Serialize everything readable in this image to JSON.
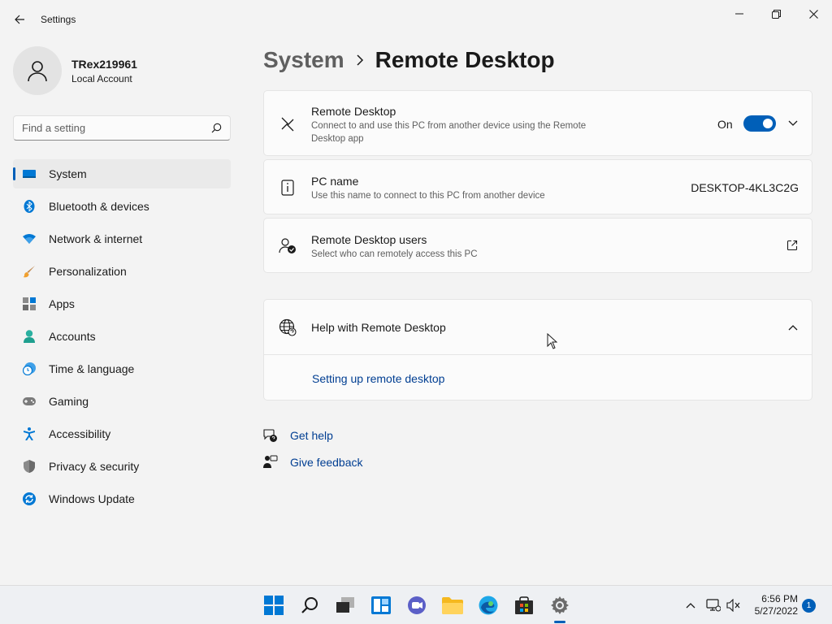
{
  "window": {
    "title": "Settings"
  },
  "profile": {
    "name": "TRex219961",
    "account_type": "Local Account"
  },
  "search": {
    "placeholder": "Find a setting"
  },
  "nav": {
    "items": [
      {
        "label": "System",
        "icon": "system-icon",
        "active": true
      },
      {
        "label": "Bluetooth & devices",
        "icon": "bluetooth-icon"
      },
      {
        "label": "Network & internet",
        "icon": "wifi-icon"
      },
      {
        "label": "Personalization",
        "icon": "brush-icon"
      },
      {
        "label": "Apps",
        "icon": "apps-icon"
      },
      {
        "label": "Accounts",
        "icon": "person-icon"
      },
      {
        "label": "Time & language",
        "icon": "clock-globe-icon"
      },
      {
        "label": "Gaming",
        "icon": "gamepad-icon"
      },
      {
        "label": "Accessibility",
        "icon": "accessibility-icon"
      },
      {
        "label": "Privacy & security",
        "icon": "shield-icon"
      },
      {
        "label": "Windows Update",
        "icon": "update-icon"
      }
    ]
  },
  "breadcrumb": {
    "parent": "System",
    "current": "Remote Desktop"
  },
  "cards": {
    "remote_desktop": {
      "title": "Remote Desktop",
      "description": "Connect to and use this PC from another device using the Remote Desktop app",
      "toggle_label": "On",
      "toggle_on": true
    },
    "pc_name": {
      "title": "PC name",
      "description": "Use this name to connect to this PC from another device",
      "value": "DESKTOP-4KL3C2G"
    },
    "users": {
      "title": "Remote Desktop users",
      "description": "Select who can remotely access this PC"
    },
    "help": {
      "title": "Help with Remote Desktop",
      "link": "Setting up remote desktop"
    }
  },
  "help_links": {
    "get_help": "Get help",
    "give_feedback": "Give feedback"
  },
  "taskbar": {
    "time": "6:56 PM",
    "date": "5/27/2022",
    "notification_count": "1"
  },
  "colors": {
    "accent": "#005fb8",
    "link": "#003e92"
  }
}
